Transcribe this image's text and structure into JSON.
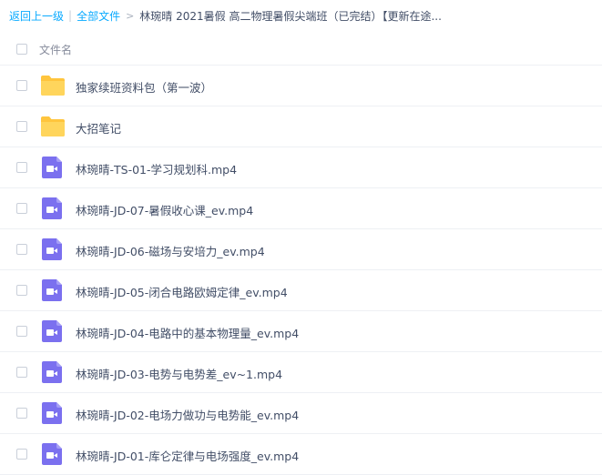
{
  "breadcrumb": {
    "back": "返回上一级",
    "separator": "|",
    "all_files": "全部文件",
    "arrow": ">",
    "current": "林琬晴 2021暑假 高二物理暑假尖端班（已完结）【更新在途..."
  },
  "header": {
    "column_name": "文件名"
  },
  "files": [
    {
      "name": "独家续班资料包（第一波）",
      "type": "folder",
      "icon": "folder-icon"
    },
    {
      "name": "大招笔记",
      "type": "folder",
      "icon": "folder-icon"
    },
    {
      "name": "林琬晴-TS-01-学习规划科.mp4",
      "type": "video",
      "icon": "video-file-icon"
    },
    {
      "name": "林琬晴-JD-07-暑假收心课_ev.mp4",
      "type": "video",
      "icon": "video-file-icon"
    },
    {
      "name": "林琬晴-JD-06-磁场与安培力_ev.mp4",
      "type": "video",
      "icon": "video-file-icon"
    },
    {
      "name": "林琬晴-JD-05-闭合电路欧姆定律_ev.mp4",
      "type": "video",
      "icon": "video-file-icon"
    },
    {
      "name": "林琬晴-JD-04-电路中的基本物理量_ev.mp4",
      "type": "video",
      "icon": "video-file-icon"
    },
    {
      "name": "林琬晴-JD-03-电势与电势差_ev~1.mp4",
      "type": "video",
      "icon": "video-file-icon"
    },
    {
      "name": "林琬晴-JD-02-电场力做功与电势能_ev.mp4",
      "type": "video",
      "icon": "video-file-icon"
    },
    {
      "name": "林琬晴-JD-01-库仑定律与电场强度_ev.mp4",
      "type": "video",
      "icon": "video-file-icon"
    }
  ],
  "colors": {
    "link": "#09aaff",
    "folder": "#ffc53d",
    "video": "#7b70ef"
  }
}
